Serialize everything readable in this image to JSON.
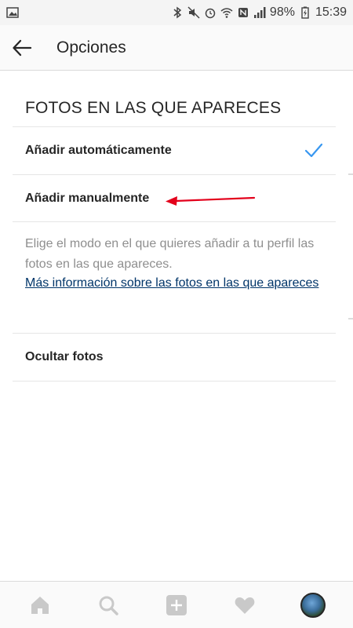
{
  "status_bar": {
    "battery": "98%",
    "time": "15:39",
    "icons": [
      "image-icon",
      "bluetooth-icon",
      "mute-icon",
      "alarm-icon",
      "wifi-icon",
      "nfc-icon",
      "signal-icon",
      "battery-icon"
    ]
  },
  "header": {
    "back_icon": "arrow-left-icon",
    "title": "Opciones"
  },
  "section": {
    "title": "FOTOS EN LAS QUE APARECES",
    "options": [
      {
        "label": "Añadir automáticamente",
        "selected": true
      },
      {
        "label": "Añadir manualmente",
        "selected": false
      }
    ],
    "description": "Elige el modo en el que quieres añadir a tu perfil las fotos en las que apareces.",
    "more_link": "Más información sobre las fotos en las que apareces",
    "hide_label": "Ocultar fotos"
  },
  "annotation": {
    "color": "#e3001b"
  },
  "bottom_nav": {
    "items": [
      "home-icon",
      "search-icon",
      "add-icon",
      "heart-icon",
      "profile-avatar"
    ]
  },
  "colors": {
    "accent": "#3897f0",
    "link": "#003569",
    "muted": "#8e8e8e",
    "text": "#262626"
  }
}
